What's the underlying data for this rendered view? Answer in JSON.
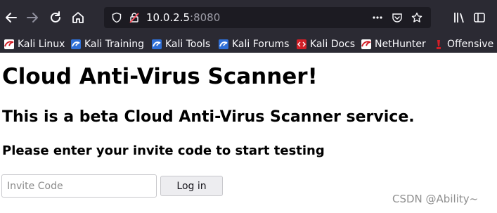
{
  "browser": {
    "url_host": "10.0.2.5",
    "url_port": ":8080",
    "nav_icons": [
      "back-icon",
      "forward-icon",
      "reload-icon",
      "home-icon"
    ],
    "urlbar_icons": [
      "shield-icon",
      "insecure-lock-icon",
      "more-icon",
      "pocket-icon",
      "star-icon"
    ],
    "right_icons": [
      "library-icon",
      "sidebar-icon"
    ]
  },
  "bookmarks": [
    {
      "label": "Kali Linux",
      "icon": "kali-dragon-icon"
    },
    {
      "label": "Kali Training",
      "icon": "kali-training-icon"
    },
    {
      "label": "Kali Tools",
      "icon": "kali-tools-icon"
    },
    {
      "label": "Kali Forums",
      "icon": "kali-forums-icon"
    },
    {
      "label": "Kali Docs",
      "icon": "kali-docs-icon"
    },
    {
      "label": "NetHunter",
      "icon": "nethunter-icon"
    },
    {
      "label": "Offensive S",
      "icon": "offensive-security-icon"
    }
  ],
  "page": {
    "heading": "Cloud Anti-Virus Scanner!",
    "subheading": "This is a beta Cloud Anti-Virus Scanner service.",
    "instruction": "Please enter your invite code to start testing",
    "invite_placeholder": "Invite Code",
    "login_label": "Log in"
  },
  "watermark": "CSDN @Ability~",
  "colors": {
    "toolbar_bg": "#2b2a33",
    "urlbar_bg": "#1c1b22",
    "kali_red": "#d21f27",
    "kali_blue": "#2f6fd6"
  }
}
